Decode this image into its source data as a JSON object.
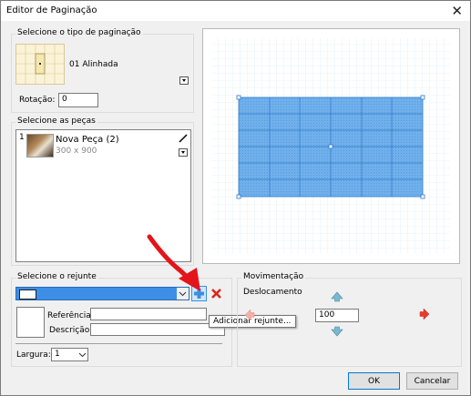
{
  "window": {
    "title": "Editor de Paginação",
    "close_glyph": "✕"
  },
  "pagination": {
    "group_label": "Selecione o tipo de paginação",
    "type_name": "01 Alinhada",
    "rotation_label": "Rotação:",
    "rotation_value": "0"
  },
  "pieces": {
    "group_label": "Selecione as peças",
    "items": [
      {
        "index": "1",
        "name": "Nova Peça (2)",
        "size": "300 x 900"
      }
    ]
  },
  "grout": {
    "group_label": "Selecione o rejunte",
    "reference_label": "Referência",
    "description_label": "Descrição",
    "reference_value": "",
    "description_value": "",
    "width_label": "Largura:",
    "width_value": "1",
    "selected_color": "#3d8ee6"
  },
  "tooltip": "Adicionar rejunte...",
  "movement": {
    "group_label": "Movimentação",
    "offset_label": "Deslocamento",
    "offset_value": "100"
  },
  "buttons": {
    "ok": "OK",
    "cancel": "Cancelar"
  },
  "colors": {
    "tile_fill": "#4f9ce6",
    "grid_line": "#cfe4f6",
    "add_icon": "#3b8ee0",
    "delete_icon": "#d7261e",
    "arrow_red": "#e63c2f"
  }
}
